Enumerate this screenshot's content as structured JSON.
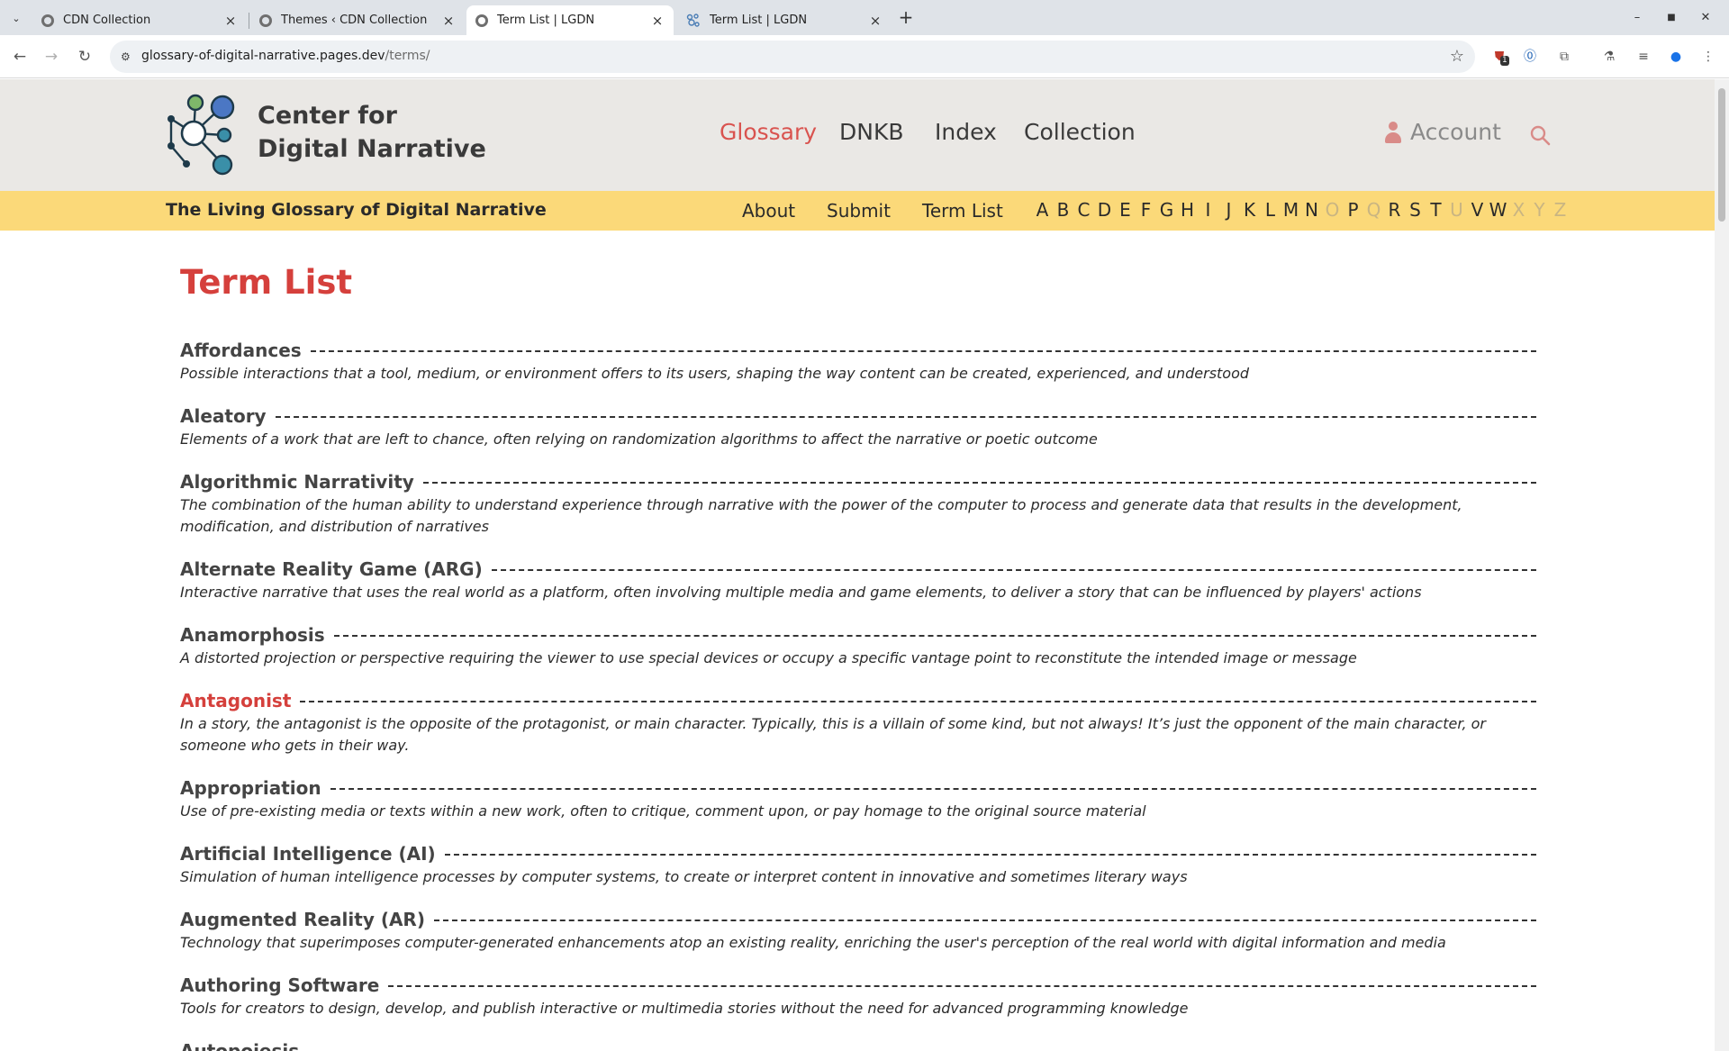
{
  "browser": {
    "tabs": [
      {
        "title": "CDN Collection",
        "active": false
      },
      {
        "title": "Themes ‹ CDN Collection",
        "active": false
      },
      {
        "title": "Term List | LGDN",
        "active": true
      },
      {
        "title": "Term List | LGDN",
        "active": false
      }
    ],
    "url_host": "glossary-of-digital-narrative.pages.dev",
    "url_path": "/terms/",
    "extension_badge": "1"
  },
  "header": {
    "brand_line1": "Center for",
    "brand_line2": "Digital Narrative",
    "nav": [
      "Glossary",
      "DNKB",
      "Index",
      "Collection"
    ],
    "active_nav": "Glossary",
    "account_label": "Account"
  },
  "subbar": {
    "title": "The Living Glossary of Digital Narrative",
    "links": [
      "About",
      "Submit",
      "Term List"
    ],
    "letters": [
      {
        "l": "A",
        "on": true
      },
      {
        "l": "B",
        "on": true
      },
      {
        "l": "C",
        "on": true
      },
      {
        "l": "D",
        "on": true
      },
      {
        "l": "E",
        "on": true
      },
      {
        "l": "F",
        "on": true
      },
      {
        "l": "G",
        "on": true
      },
      {
        "l": "H",
        "on": true
      },
      {
        "l": "I",
        "on": true
      },
      {
        "l": "J",
        "on": true
      },
      {
        "l": "K",
        "on": true
      },
      {
        "l": "L",
        "on": true
      },
      {
        "l": "M",
        "on": true
      },
      {
        "l": "N",
        "on": true
      },
      {
        "l": "O",
        "on": false
      },
      {
        "l": "P",
        "on": true
      },
      {
        "l": "Q",
        "on": false
      },
      {
        "l": "R",
        "on": true
      },
      {
        "l": "S",
        "on": true
      },
      {
        "l": "T",
        "on": true
      },
      {
        "l": "U",
        "on": false
      },
      {
        "l": "V",
        "on": true
      },
      {
        "l": "W",
        "on": true
      },
      {
        "l": "X",
        "on": false
      },
      {
        "l": "Y",
        "on": false
      },
      {
        "l": "Z",
        "on": false
      }
    ]
  },
  "main": {
    "title": "Term List",
    "terms": [
      {
        "name": "Affordances",
        "def": "Possible interactions that a tool, medium, or environment offers to its users, shaping the way content can be created, experienced, and understood"
      },
      {
        "name": "Aleatory",
        "def": "Elements of a work that are left to chance, often relying on randomization algorithms to affect the narrative or poetic outcome"
      },
      {
        "name": "Algorithmic Narrativity",
        "def": "The combination of the human ability to understand experience through narrative with the power of the computer to process and generate data that results in the development, modification, and distribution of narratives"
      },
      {
        "name": "Alternate Reality Game (ARG)",
        "def": "Interactive narrative that uses the real world as a platform, often involving multiple media and game elements, to deliver a story that can be influenced by players' actions"
      },
      {
        "name": "Anamorphosis",
        "def": "A distorted projection or perspective requiring the viewer to use special devices or occupy a specific vantage point to reconstitute the intended image or message"
      },
      {
        "name": "Antagonist",
        "def": "In a story, the antagonist is the opposite of the protagonist, or main character. Typically, this is a villain of some kind, but not always! It’s just the opponent of the main character, or someone who gets in their way.",
        "highlight": true
      },
      {
        "name": "Appropriation",
        "def": "Use of pre-existing media or texts within a new work, often to critique, comment upon, or pay homage to the original source material"
      },
      {
        "name": "Artificial Intelligence (AI)",
        "def": "Simulation of human intelligence processes by computer systems, to create or interpret content in innovative and sometimes literary ways"
      },
      {
        "name": "Augmented Reality (AR)",
        "def": "Technology that superimposes computer-generated enhancements atop an existing reality, enriching the user's perception of the real world with digital information and media"
      },
      {
        "name": "Authoring Software",
        "def": "Tools for creators to design, develop, and publish interactive or multimedia stories without the need for advanced programming knowledge"
      },
      {
        "name": "Autopoiesis",
        "def": ""
      }
    ]
  },
  "colors": {
    "accent_red": "#d5403c",
    "subbar_yellow": "#fbd979",
    "header_gray": "#eae8e5"
  }
}
